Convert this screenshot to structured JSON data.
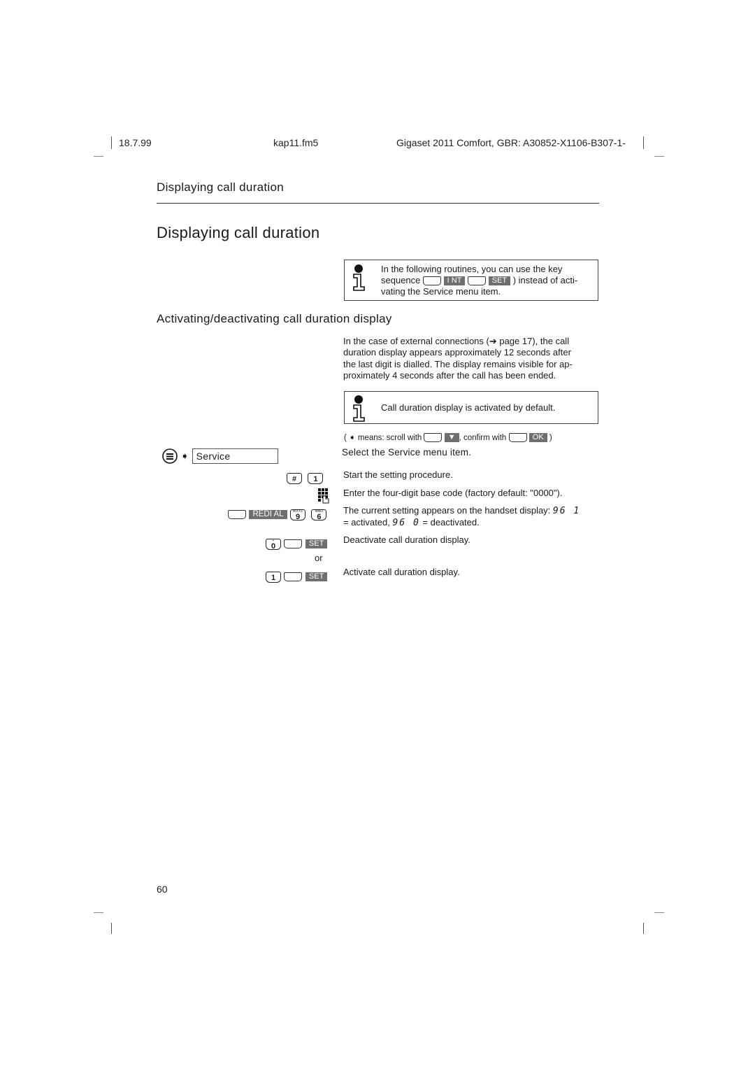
{
  "header": {
    "date": "18.7.99",
    "file": "kap11.fm5",
    "product": "Gigaset 2011 Comfort, GBR: A30852-X1106-B307-1-"
  },
  "running_head": "Displaying call duration",
  "title": "Displaying call duration",
  "note1": {
    "icon": "info-icon",
    "line1": "In the following routines, you can use the key",
    "line2_prefix": "sequence",
    "key_int": "I NT",
    "key_set": "SET",
    "line2_suffix": ") instead of acti-",
    "line3": "vating the Service menu item."
  },
  "subtitle": "Activating/deactivating call duration display",
  "intro": [
    "In the case of external connections (➔ page 17), the call",
    "duration display appears approximately 12 seconds after",
    "the last digit is dialled. The display remains visible for ap-",
    "proximately 4 seconds after the call has been ended."
  ],
  "note2": {
    "icon": "info-icon",
    "text": "Call duration display is activated by default."
  },
  "legend": {
    "open": "(",
    "means": "means: scroll with",
    "confirm": ", confirm with",
    "ok": "OK",
    "close": ")"
  },
  "steps": [
    {
      "keys": "menu-key, arrow, Service",
      "menu_field": "Service",
      "text": "Select the Service menu item."
    },
    {
      "keys": [
        "#",
        "1"
      ],
      "text": "Start the setting procedure."
    },
    {
      "keys": "keypad-icon",
      "text": "Enter the four-digit base code (factory default: \"0000\")."
    },
    {
      "keys": [
        "REDI AL",
        "9",
        "6"
      ],
      "text_pre": "The current setting appears on the handset display:",
      "lcd_on": "96 1",
      "text_mid1": "= activated,",
      "lcd_off": "96 0",
      "text_mid2": "= deactivated."
    },
    {
      "keys": [
        "0",
        "SET"
      ],
      "text": "Deactivate call duration display."
    },
    {
      "or": "or"
    },
    {
      "keys": [
        "1",
        "SET"
      ],
      "text": "Activate call duration display."
    }
  ],
  "key_labels": {
    "redial": "REDI AL",
    "set": "SET",
    "nine": "9",
    "six": "6",
    "zero": "0",
    "one": "1",
    "hash": "#",
    "nine_sub": "WXYZ",
    "six_sub": "MNO",
    "zero_sub": "+"
  },
  "page_number": "60"
}
